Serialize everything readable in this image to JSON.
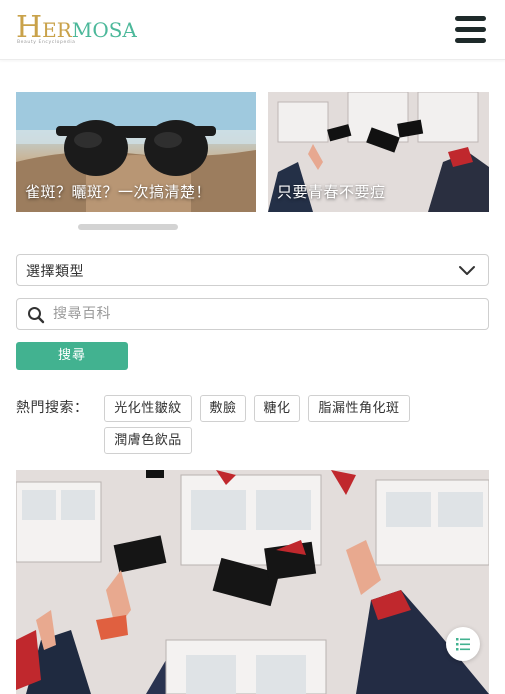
{
  "header": {
    "logo_text_h": "H",
    "logo_text_er": "ER",
    "logo_text_mosa": "MOSA",
    "logo_tagline": "Beauty Encyclopedia",
    "menu_icon": "hamburger-menu-icon"
  },
  "carousel": {
    "cards": [
      {
        "title": "雀斑？曬斑？一次搞清楚！"
      },
      {
        "title": "只要青春不要痘"
      }
    ]
  },
  "filter": {
    "select_value": "選擇類型",
    "search_placeholder": "搜尋百科",
    "search_button": "搜尋"
  },
  "hot_searches": {
    "label": "熱門搜索：",
    "tags": [
      "光化性皺紋",
      "敷臉",
      "糖化",
      "脂漏性角化斑",
      "潤膚色飲品"
    ]
  },
  "colors": {
    "accent_green": "#42b290",
    "logo_gold": "#c9a24a",
    "logo_green": "#4cb89a"
  }
}
